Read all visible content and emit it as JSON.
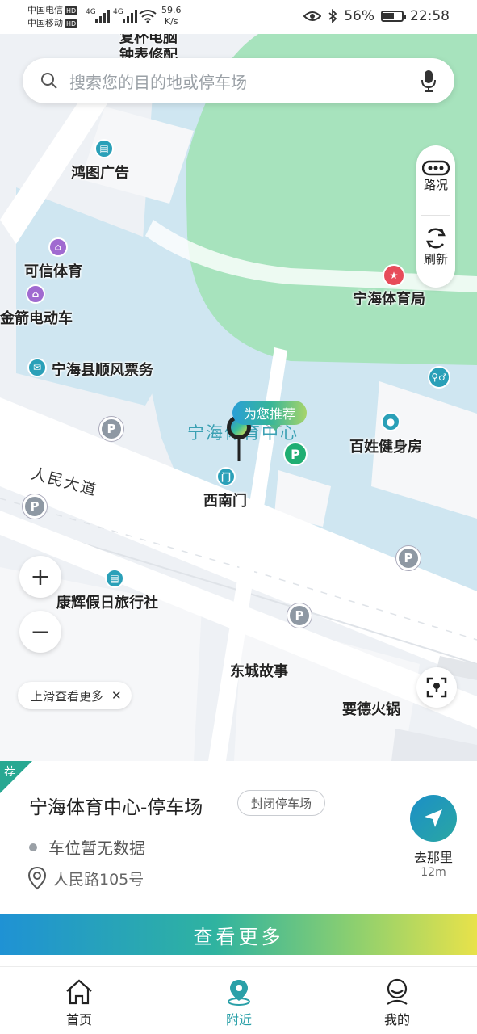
{
  "status_bar": {
    "carrier1": "中国电信",
    "carrier2": "中国移动",
    "hd": "HD",
    "net_type": "4G",
    "speed_value": "59.6",
    "speed_unit": "K/s",
    "battery": "56%",
    "time": "22:58"
  },
  "search": {
    "placeholder": "搜索您的目的地或停车场"
  },
  "map_labels": {
    "top_partial_1": "复杯电脑",
    "top_partial_2": "钟表修配",
    "hongtu": "鸿图广告",
    "kexin": "可信体育",
    "jinjian": "金箭电动车",
    "shunfeng": "宁海县顺风票务",
    "sports_bureau": "宁海体育局",
    "venue": "宁海体育中心",
    "baixing": "百姓健身房",
    "renmin_road": "人民大道",
    "xinanmen": "西南门",
    "kanghui": "康辉假日旅行社",
    "dongcheng": "东城故事",
    "yaode": "要德火锅",
    "recommend_bubble": "为您推荐",
    "parking_letter": "P"
  },
  "side_panel": {
    "traffic": "路况",
    "refresh": "刷新"
  },
  "zoom": {
    "in": "+",
    "out": "−"
  },
  "hint": {
    "text": "上滑查看更多",
    "close": "✕"
  },
  "card": {
    "corner": "荐",
    "name": "宁海体育中心-停车场",
    "tag": "封闭停车场",
    "spaces": "车位暂无数据",
    "address": "人民路105号",
    "goto_label": "去那里",
    "distance": "12m"
  },
  "more_button": "查看更多",
  "tabs": [
    {
      "label": "首页",
      "icon": "home-icon"
    },
    {
      "label": "附近",
      "icon": "location-pin-icon"
    },
    {
      "label": "我的",
      "icon": "user-icon"
    }
  ],
  "colors": {
    "accent": "#2aa0a8",
    "water": "#cfe6f1",
    "park": "#a7e3bd",
    "parking_green": "#1fae72"
  }
}
